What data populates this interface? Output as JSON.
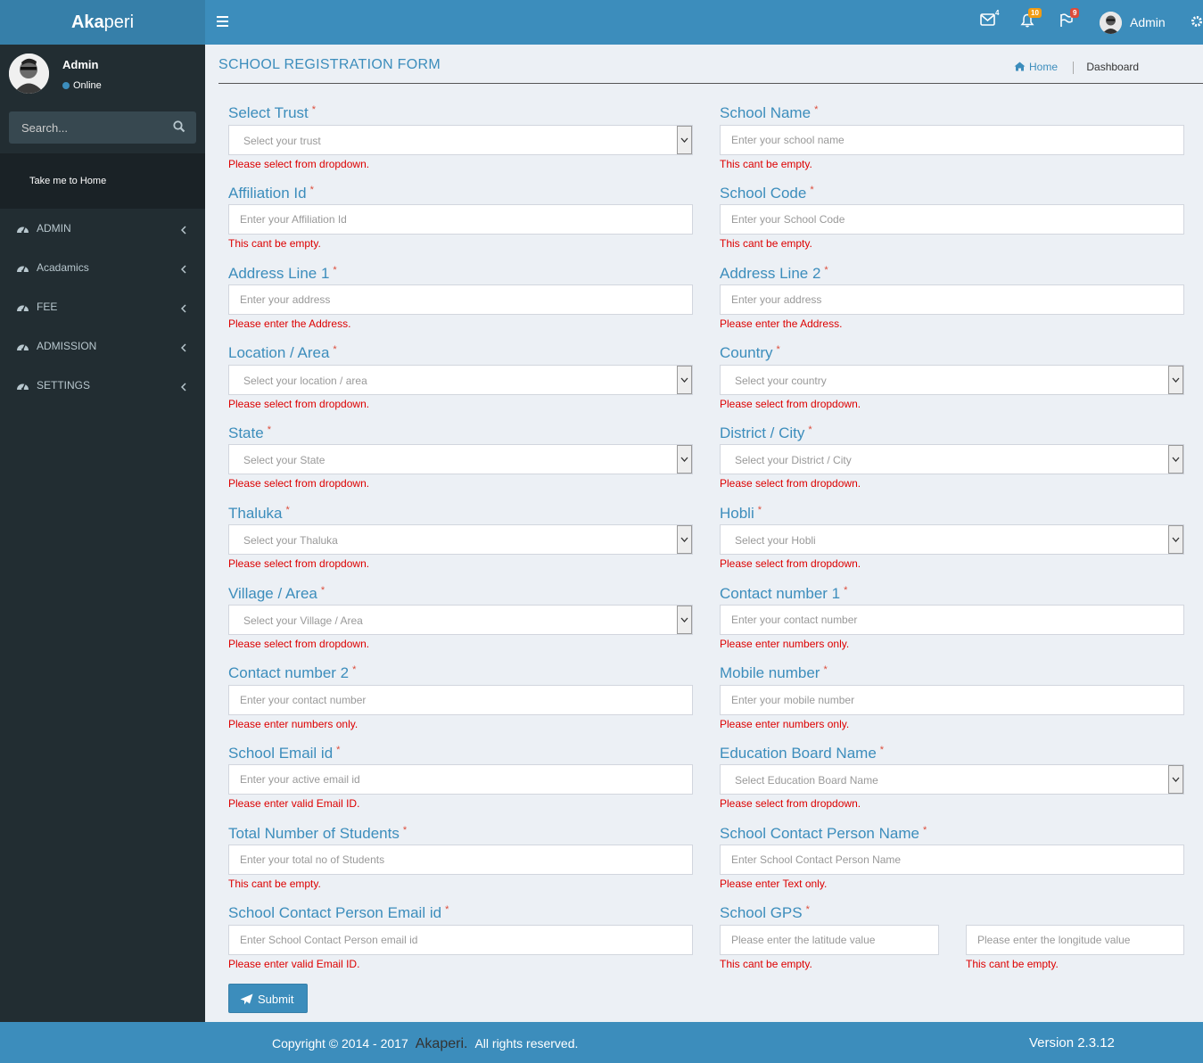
{
  "header": {
    "brand_bold": "Aka",
    "brand_rest": "peri",
    "badges": {
      "mail": "4",
      "bell": "10",
      "flag": "9"
    },
    "user_name": "Admin"
  },
  "sidebar": {
    "user_name": "Admin",
    "status": "Online",
    "search_placeholder": "Search...",
    "home_link": "Take me to Home",
    "menu": [
      {
        "label": "ADMIN"
      },
      {
        "label": "Acadamics"
      },
      {
        "label": "FEE"
      },
      {
        "label": "ADMISSION"
      },
      {
        "label": "SETTINGS"
      }
    ]
  },
  "page": {
    "title": "SCHOOL REGISTRATION FORM",
    "breadcrumb_home": "Home",
    "breadcrumb_current": "Dashboard"
  },
  "form": {
    "trust": {
      "label": "Select Trust",
      "placeholder": "Select your trust",
      "error": "Please select from dropdown."
    },
    "school_name": {
      "label": "School Name",
      "placeholder": "Enter your school name",
      "error": "This cant be empty."
    },
    "affiliation_id": {
      "label": "Affiliation Id",
      "placeholder": "Enter your Affiliation Id",
      "error": "This cant be empty."
    },
    "school_code": {
      "label": "School Code",
      "placeholder": "Enter your School Code",
      "error": "This cant be empty."
    },
    "address1": {
      "label": "Address Line 1",
      "placeholder": "Enter your address",
      "error": "Please enter the Address."
    },
    "address2": {
      "label": "Address Line 2",
      "placeholder": "Enter your address",
      "error": "Please enter the Address."
    },
    "location": {
      "label": "Location / Area",
      "placeholder": "Select your location / area",
      "error": "Please select from dropdown."
    },
    "country": {
      "label": "Country",
      "placeholder": "Select your country",
      "error": "Please select from dropdown."
    },
    "state": {
      "label": "State",
      "placeholder": "Select your State",
      "error": "Please select from dropdown."
    },
    "district": {
      "label": "District / City",
      "placeholder": "Select your District / City",
      "error": "Please select from dropdown."
    },
    "thaluka": {
      "label": "Thaluka",
      "placeholder": "Select your Thaluka",
      "error": "Please select from dropdown."
    },
    "hobli": {
      "label": "Hobli",
      "placeholder": "Select your Hobli",
      "error": "Please select from dropdown."
    },
    "village": {
      "label": "Village / Area",
      "placeholder": "Select your Village / Area",
      "error": "Please select from dropdown."
    },
    "contact1": {
      "label": "Contact number 1",
      "placeholder": "Enter your contact number",
      "error": "Please enter numbers only."
    },
    "contact2": {
      "label": "Contact number 2",
      "placeholder": "Enter your contact number",
      "error": "Please enter numbers only."
    },
    "mobile": {
      "label": "Mobile number",
      "placeholder": "Enter your mobile number",
      "error": "Please enter numbers only."
    },
    "email": {
      "label": "School Email id",
      "placeholder": "Enter your active email id",
      "error": "Please enter valid Email ID."
    },
    "board": {
      "label": "Education Board Name",
      "placeholder": "Select Education Board Name",
      "error": "Please select from dropdown."
    },
    "students": {
      "label": "Total Number of Students",
      "placeholder": "Enter your total no of Students",
      "error": "This cant be empty."
    },
    "contact_person": {
      "label": "School Contact Person Name",
      "placeholder": "Enter School Contact Person Name",
      "error": "Please enter Text only."
    },
    "contact_email": {
      "label": "School Contact Person Email id",
      "placeholder": "Enter School Contact Person email id",
      "error": "Please enter valid Email ID."
    },
    "gps": {
      "label": "School GPS",
      "lat_placeholder": "Please enter the latitude value",
      "lng_placeholder": "Please enter the longitude value",
      "lat_error": "This cant be empty.",
      "lng_error": "This cant be empty."
    },
    "required_mark": "*",
    "submit_label": "Submit"
  },
  "footer": {
    "copyright": "Copyright © 2014 - 2017",
    "brand": "Akaperi.",
    "rights": "All rights reserved.",
    "version": "Version 2.3.12"
  }
}
